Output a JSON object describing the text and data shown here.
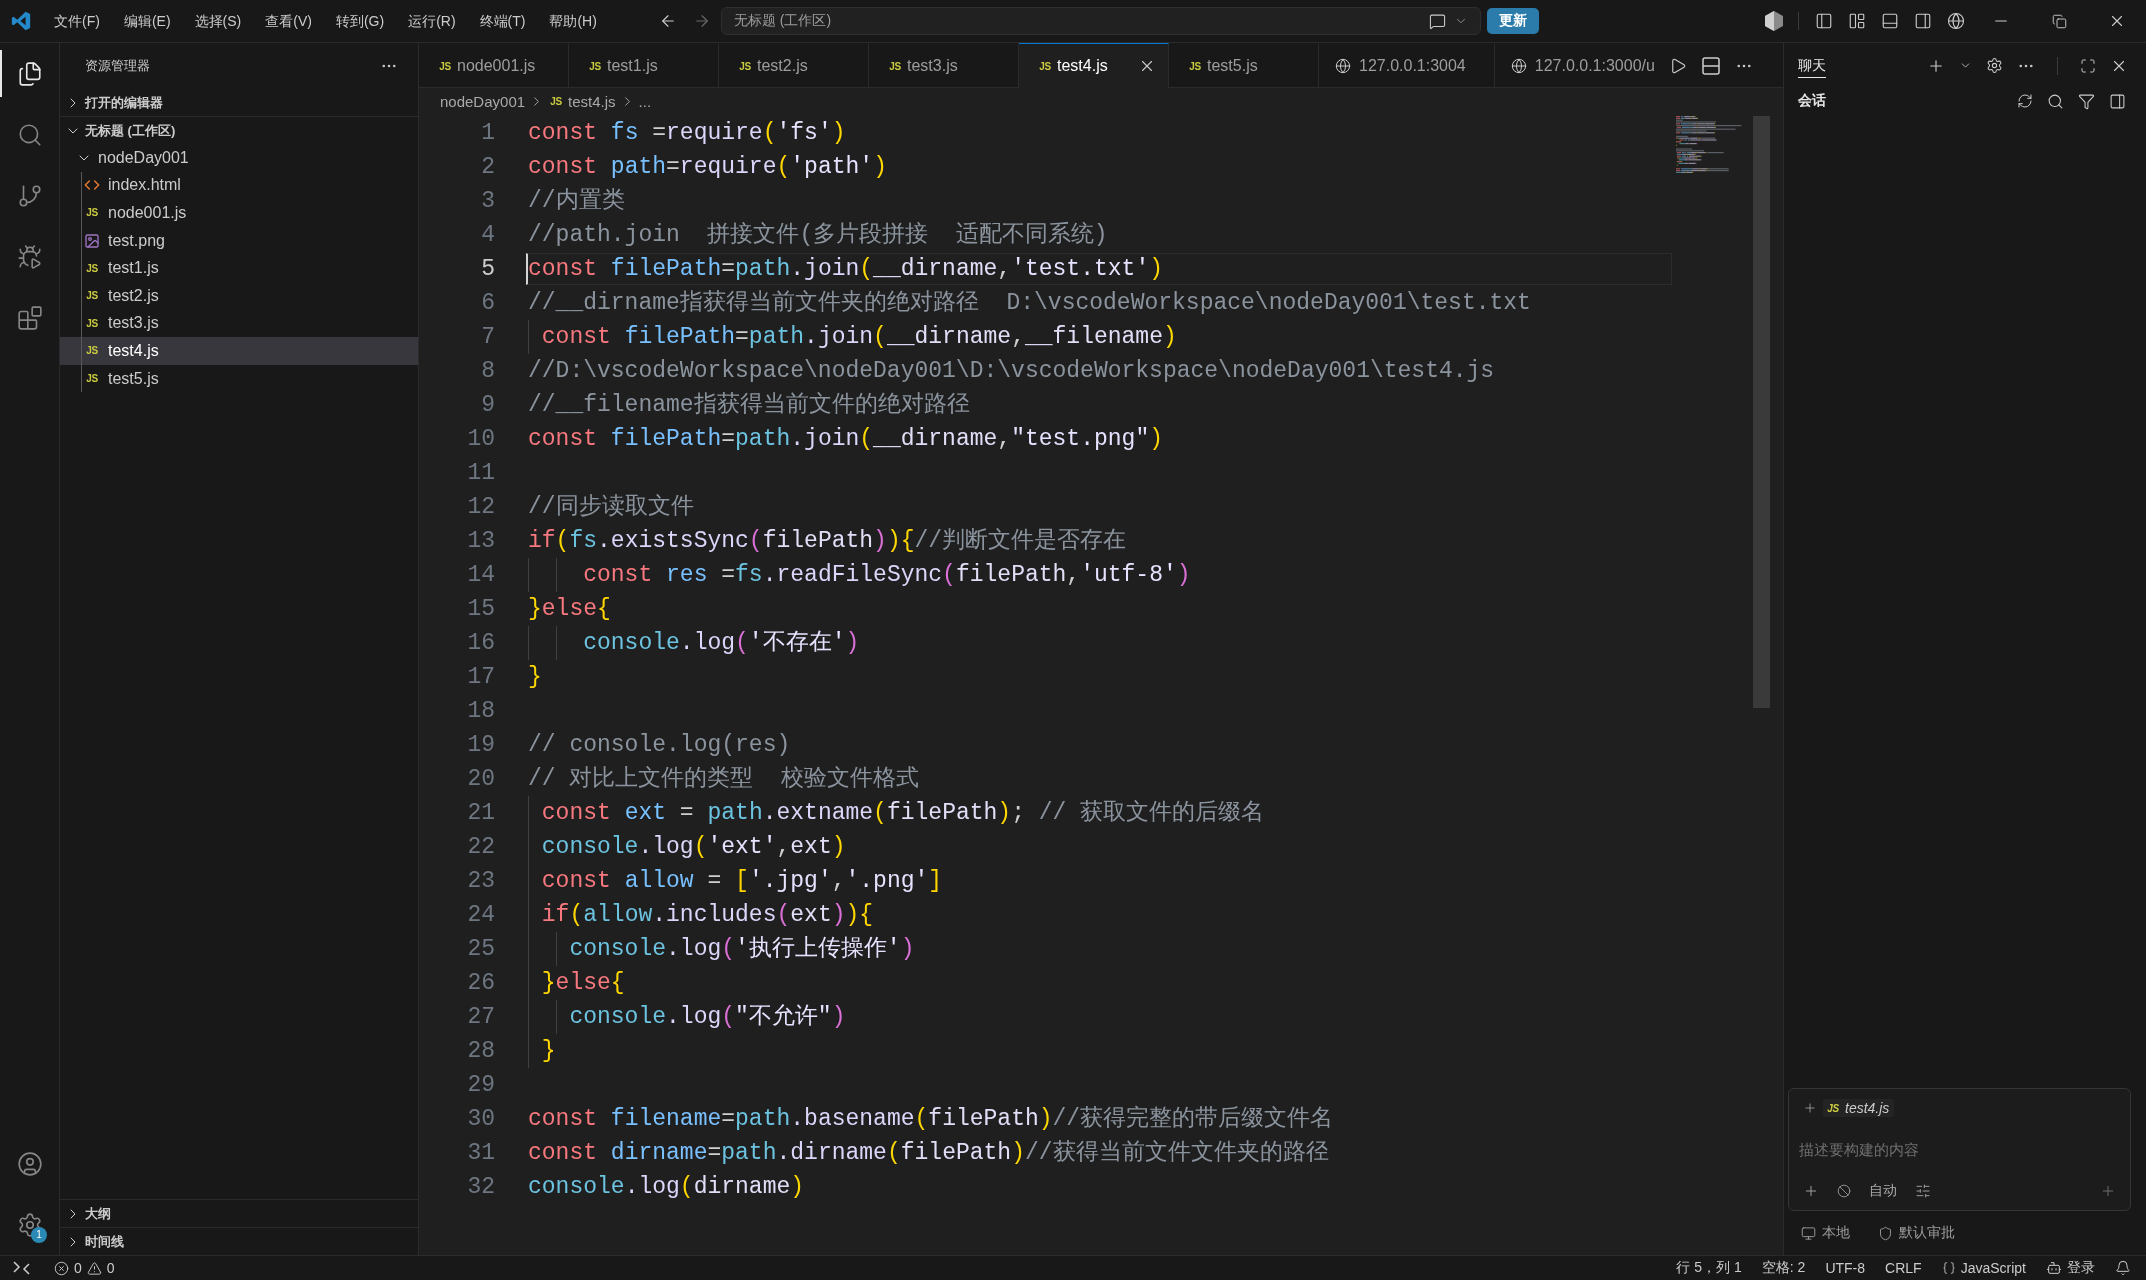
{
  "title_bar": {
    "menus": [
      "文件(F)",
      "编辑(E)",
      "选择(S)",
      "查看(V)",
      "转到(G)",
      "运行(R)",
      "终端(T)",
      "帮助(H)"
    ],
    "command_center": "无标题 (工作区)",
    "update_button": "更新"
  },
  "activity_bar": {
    "items": [
      {
        "kind": "explorer",
        "selected": true
      },
      {
        "kind": "search",
        "selected": false
      },
      {
        "kind": "source_control",
        "selected": false
      },
      {
        "kind": "run_debug",
        "selected": false
      },
      {
        "kind": "extensions",
        "selected": false
      }
    ],
    "bottom_items": [
      {
        "kind": "account"
      },
      {
        "kind": "settings",
        "badge": "1"
      }
    ]
  },
  "sidebar": {
    "title": "资源管理器",
    "sections": [
      {
        "label": "打开的编辑器",
        "expanded": false
      },
      {
        "label": "无标题 (工作区)",
        "expanded": true,
        "children": [
          {
            "kind": "folder",
            "name": "nodeDay001",
            "expanded": true,
            "selected": false,
            "children": [
              {
                "kind": "html",
                "name": "index.html",
                "selected": false
              },
              {
                "kind": "js",
                "icon_label": "JS",
                "name": "node001.js",
                "selected": false
              },
              {
                "kind": "image",
                "name": "test.png",
                "selected": false
              },
              {
                "kind": "js",
                "icon_label": "JS",
                "name": "test1.js",
                "selected": false
              },
              {
                "kind": "js",
                "icon_label": "JS",
                "name": "test2.js",
                "selected": false
              },
              {
                "kind": "js",
                "icon_label": "JS",
                "name": "test3.js",
                "selected": false
              },
              {
                "kind": "js",
                "icon_label": "JS",
                "name": "test4.js",
                "selected": true
              },
              {
                "kind": "js",
                "icon_label": "JS",
                "name": "test5.js",
                "selected": false
              }
            ]
          }
        ]
      }
    ],
    "bottom_sections": [
      {
        "label": "大纲",
        "expanded": false
      },
      {
        "label": "时间线",
        "expanded": false
      }
    ]
  },
  "editor": {
    "tabs": [
      {
        "kind": "js",
        "icon_label": "JS",
        "label": "node001.js",
        "selected": false
      },
      {
        "kind": "js",
        "icon_label": "JS",
        "label": "test1.js",
        "selected": false
      },
      {
        "kind": "js",
        "icon_label": "JS",
        "label": "test2.js",
        "selected": false
      },
      {
        "kind": "js",
        "icon_label": "JS",
        "label": "test3.js",
        "selected": false
      },
      {
        "kind": "js",
        "icon_label": "JS",
        "label": "test4.js",
        "selected": true
      },
      {
        "kind": "js",
        "icon_label": "JS",
        "label": "test5.js",
        "selected": false
      },
      {
        "kind": "browser",
        "label": "127.0.0.1:3004",
        "selected": false
      },
      {
        "kind": "browser",
        "label": "127.0.0.1:3000/u",
        "selected": false
      }
    ],
    "breadcrumb": [
      {
        "kind": "folder",
        "label": "nodeDay001"
      },
      {
        "kind": "js",
        "icon_label": "JS",
        "label": "test4.js"
      },
      {
        "kind": "more",
        "label": "..."
      }
    ],
    "lines": [
      {
        "number": "1",
        "current": false,
        "tokens": [
          {
            "kind": "keyword",
            "text": "const "
          },
          {
            "kind": "variable",
            "text": "fs"
          },
          {
            "kind": "plain",
            "text": " ="
          },
          {
            "kind": "function",
            "text": "require"
          },
          {
            "kind": "bracket1",
            "text": "("
          },
          {
            "kind": "string",
            "text": "'fs'"
          },
          {
            "kind": "bracket1",
            "text": ")"
          }
        ]
      },
      {
        "number": "2",
        "current": false,
        "tokens": [
          {
            "kind": "keyword",
            "text": "const "
          },
          {
            "kind": "variable",
            "text": "path"
          },
          {
            "kind": "plain",
            "text": "="
          },
          {
            "kind": "function",
            "text": "require"
          },
          {
            "kind": "bracket1",
            "text": "("
          },
          {
            "kind": "string",
            "text": "'path'"
          },
          {
            "kind": "bracket1",
            "text": ")"
          }
        ]
      },
      {
        "number": "3",
        "current": false,
        "tokens": [
          {
            "kind": "comment",
            "text": "//内置类"
          }
        ]
      },
      {
        "number": "4",
        "current": false,
        "tokens": [
          {
            "kind": "comment",
            "text": "//path.join  拼接文件(多片段拼接  适配不同系统)"
          }
        ]
      },
      {
        "number": "5",
        "current": true,
        "tokens": [
          {
            "kind": "keyword",
            "text": "const "
          },
          {
            "kind": "variable",
            "text": "filePath"
          },
          {
            "kind": "plain",
            "text": "="
          },
          {
            "kind": "object",
            "text": "path"
          },
          {
            "kind": "function",
            "text": ".join"
          },
          {
            "kind": "bracket1",
            "text": "("
          },
          {
            "kind": "identifier",
            "text": "__dirname"
          },
          {
            "kind": "plain",
            "text": ","
          },
          {
            "kind": "string",
            "text": "'test.txt'"
          },
          {
            "kind": "bracket1",
            "text": ")"
          }
        ]
      },
      {
        "number": "6",
        "current": false,
        "tokens": [
          {
            "kind": "comment",
            "text": "//__dirname指获得当前文件夹的绝对路径  D:\\vscodeWorkspace\\nodeDay001\\test.txt"
          }
        ]
      },
      {
        "number": "7",
        "current": false,
        "tokens": [
          {
            "kind": "keyword",
            "text": " const "
          },
          {
            "kind": "variable",
            "text": "filePath"
          },
          {
            "kind": "plain",
            "text": "="
          },
          {
            "kind": "object",
            "text": "path"
          },
          {
            "kind": "function",
            "text": ".join"
          },
          {
            "kind": "bracket1",
            "text": "("
          },
          {
            "kind": "identifier",
            "text": "__dirname"
          },
          {
            "kind": "plain",
            "text": ","
          },
          {
            "kind": "identifier",
            "text": "__filename"
          },
          {
            "kind": "bracket1",
            "text": ")"
          }
        ]
      },
      {
        "number": "8",
        "current": false,
        "tokens": [
          {
            "kind": "comment",
            "text": "//D:\\vscodeWorkspace\\nodeDay001\\D:\\vscodeWorkspace\\nodeDay001\\test4.js"
          }
        ]
      },
      {
        "number": "9",
        "current": false,
        "tokens": [
          {
            "kind": "comment",
            "text": "//__filename指获得当前文件的绝对路径"
          }
        ]
      },
      {
        "number": "10",
        "current": false,
        "tokens": [
          {
            "kind": "keyword",
            "text": "const "
          },
          {
            "kind": "variable",
            "text": "filePath"
          },
          {
            "kind": "plain",
            "text": "="
          },
          {
            "kind": "object",
            "text": "path"
          },
          {
            "kind": "function",
            "text": ".join"
          },
          {
            "kind": "bracket1",
            "text": "("
          },
          {
            "kind": "identifier",
            "text": "__dirname"
          },
          {
            "kind": "plain",
            "text": ","
          },
          {
            "kind": "string",
            "text": "\"test.png\""
          },
          {
            "kind": "bracket1",
            "text": ")"
          }
        ]
      },
      {
        "number": "11",
        "current": false
      },
      {
        "number": "12",
        "current": false,
        "tokens": [
          {
            "kind": "comment",
            "text": "//同步读取文件"
          }
        ]
      },
      {
        "number": "13",
        "current": false,
        "tokens": [
          {
            "kind": "keyword",
            "text": "if"
          },
          {
            "kind": "bracket1",
            "text": "("
          },
          {
            "kind": "object",
            "text": "fs"
          },
          {
            "kind": "function",
            "text": ".existsSync"
          },
          {
            "kind": "bracket2",
            "text": "("
          },
          {
            "kind": "identifier",
            "text": "filePath"
          },
          {
            "kind": "bracket2",
            "text": ")"
          },
          {
            "kind": "bracket1",
            "text": ")"
          },
          {
            "kind": "bracket1",
            "text": "{"
          },
          {
            "kind": "comment",
            "text": "//判断文件是否存在"
          }
        ]
      },
      {
        "number": "14",
        "current": false,
        "tokens": [
          {
            "kind": "keyword",
            "text": "    const "
          },
          {
            "kind": "variable",
            "text": "res"
          },
          {
            "kind": "plain",
            "text": " ="
          },
          {
            "kind": "object",
            "text": "fs"
          },
          {
            "kind": "function",
            "text": ".readFileSync"
          },
          {
            "kind": "bracket2",
            "text": "("
          },
          {
            "kind": "identifier",
            "text": "filePath"
          },
          {
            "kind": "plain",
            "text": ","
          },
          {
            "kind": "string",
            "text": "'utf-8'"
          },
          {
            "kind": "bracket2",
            "text": ")"
          }
        ]
      },
      {
        "number": "15",
        "current": false,
        "tokens": [
          {
            "kind": "bracket1",
            "text": "}"
          },
          {
            "kind": "keyword",
            "text": "else"
          },
          {
            "kind": "bracket1",
            "text": "{"
          }
        ]
      },
      {
        "number": "16",
        "current": false,
        "tokens": [
          {
            "kind": "object",
            "text": "    console"
          },
          {
            "kind": "function",
            "text": ".log"
          },
          {
            "kind": "bracket2",
            "text": "("
          },
          {
            "kind": "string",
            "text": "'不存在'"
          },
          {
            "kind": "bracket2",
            "text": ")"
          }
        ]
      },
      {
        "number": "17",
        "current": false,
        "tokens": [
          {
            "kind": "bracket1",
            "text": "}"
          }
        ]
      },
      {
        "number": "18",
        "current": false
      },
      {
        "number": "19",
        "current": false,
        "tokens": [
          {
            "kind": "comment",
            "text": "// console.log(res)"
          }
        ]
      },
      {
        "number": "20",
        "current": false,
        "tokens": [
          {
            "kind": "comment",
            "text": "// 对比上文件的类型  校验文件格式"
          }
        ]
      },
      {
        "number": "21",
        "current": false,
        "tokens": [
          {
            "kind": "keyword",
            "text": " const "
          },
          {
            "kind": "variable",
            "text": "ext"
          },
          {
            "kind": "plain",
            "text": " = "
          },
          {
            "kind": "object",
            "text": "path"
          },
          {
            "kind": "function",
            "text": ".extname"
          },
          {
            "kind": "bracket1",
            "text": "("
          },
          {
            "kind": "identifier",
            "text": "filePath"
          },
          {
            "kind": "bracket1",
            "text": ")"
          },
          {
            "kind": "plain",
            "text": ";"
          },
          {
            "kind": "comment",
            "text": " // 获取文件的后缀名"
          }
        ]
      },
      {
        "number": "22",
        "current": false,
        "tokens": [
          {
            "kind": "object",
            "text": " console"
          },
          {
            "kind": "function",
            "text": ".log"
          },
          {
            "kind": "bracket1",
            "text": "("
          },
          {
            "kind": "string",
            "text": "'ext'"
          },
          {
            "kind": "plain",
            "text": ","
          },
          {
            "kind": "identifier",
            "text": "ext"
          },
          {
            "kind": "bracket1",
            "text": ")"
          }
        ]
      },
      {
        "number": "23",
        "current": false,
        "tokens": [
          {
            "kind": "keyword",
            "text": " const "
          },
          {
            "kind": "variable",
            "text": "allow"
          },
          {
            "kind": "plain",
            "text": " = "
          },
          {
            "kind": "bracket1",
            "text": "["
          },
          {
            "kind": "string",
            "text": "'.jpg'"
          },
          {
            "kind": "plain",
            "text": ","
          },
          {
            "kind": "string",
            "text": "'.png'"
          },
          {
            "kind": "bracket1",
            "text": "]"
          }
        ]
      },
      {
        "number": "24",
        "current": false,
        "tokens": [
          {
            "kind": "keyword",
            "text": " if"
          },
          {
            "kind": "bracket1",
            "text": "("
          },
          {
            "kind": "object",
            "text": "allow"
          },
          {
            "kind": "function",
            "text": ".includes"
          },
          {
            "kind": "bracket2",
            "text": "("
          },
          {
            "kind": "identifier",
            "text": "ext"
          },
          {
            "kind": "bracket2",
            "text": ")"
          },
          {
            "kind": "bracket1",
            "text": ")"
          },
          {
            "kind": "bracket1",
            "text": "{"
          }
        ]
      },
      {
        "number": "25",
        "current": false,
        "tokens": [
          {
            "kind": "object",
            "text": "   console"
          },
          {
            "kind": "function",
            "text": ".log"
          },
          {
            "kind": "bracket2",
            "text": "("
          },
          {
            "kind": "string",
            "text": "'执行上传操作'"
          },
          {
            "kind": "bracket2",
            "text": ")"
          }
        ]
      },
      {
        "number": "26",
        "current": false,
        "tokens": [
          {
            "kind": "bracket1",
            "text": " }"
          },
          {
            "kind": "keyword",
            "text": "else"
          },
          {
            "kind": "bracket1",
            "text": "{"
          }
        ]
      },
      {
        "number": "27",
        "current": false,
        "tokens": [
          {
            "kind": "object",
            "text": "   console"
          },
          {
            "kind": "function",
            "text": ".log"
          },
          {
            "kind": "bracket2",
            "text": "("
          },
          {
            "kind": "string",
            "text": "\"不允许\""
          },
          {
            "kind": "bracket2",
            "text": ")"
          }
        ]
      },
      {
        "number": "28",
        "current": false,
        "tokens": [
          {
            "kind": "bracket1",
            "text": " }"
          }
        ]
      },
      {
        "number": "29",
        "current": false
      },
      {
        "number": "30",
        "current": false,
        "tokens": [
          {
            "kind": "keyword",
            "text": "const "
          },
          {
            "kind": "variable",
            "text": "filename"
          },
          {
            "kind": "plain",
            "text": "="
          },
          {
            "kind": "object",
            "text": "path"
          },
          {
            "kind": "function",
            "text": ".basename"
          },
          {
            "kind": "bracket1",
            "text": "("
          },
          {
            "kind": "identifier",
            "text": "filePath"
          },
          {
            "kind": "bracket1",
            "text": ")"
          },
          {
            "kind": "comment",
            "text": "//获得完整的带后缀文件名"
          }
        ]
      },
      {
        "number": "31",
        "current": false,
        "tokens": [
          {
            "kind": "keyword",
            "text": "const "
          },
          {
            "kind": "variable",
            "text": "dirname"
          },
          {
            "kind": "plain",
            "text": "="
          },
          {
            "kind": "object",
            "text": "path"
          },
          {
            "kind": "function",
            "text": ".dirname"
          },
          {
            "kind": "bracket1",
            "text": "("
          },
          {
            "kind": "identifier",
            "text": "filePath"
          },
          {
            "kind": "bracket1",
            "text": ")"
          },
          {
            "kind": "comment",
            "text": "//获得当前文件文件夹的路径"
          }
        ]
      },
      {
        "number": "32",
        "current": false,
        "tokens": [
          {
            "kind": "object",
            "text": "console"
          },
          {
            "kind": "function",
            "text": ".log"
          },
          {
            "kind": "bracket1",
            "text": "("
          },
          {
            "kind": "identifier",
            "text": "dirname"
          },
          {
            "kind": "bracket1",
            "text": ")"
          }
        ]
      }
    ]
  },
  "chat": {
    "tabs": [
      {
        "label": "聊天",
        "selected": true
      }
    ],
    "section_title": "会话",
    "input": {
      "attachment": {
        "icon_label": "JS",
        "name": "test4.js"
      },
      "placeholder": "描述要构建的内容",
      "mode": "自动"
    },
    "footer": [
      {
        "kind": "local",
        "label": "本地"
      },
      {
        "kind": "approval",
        "label": "默认审批"
      }
    ]
  },
  "status_bar": {
    "errors": "0",
    "warnings": "0",
    "items": [
      {
        "kind": "text",
        "label": "行 5，列 1"
      },
      {
        "kind": "text",
        "label": "空格: 2"
      },
      {
        "kind": "text",
        "label": "UTF-8"
      },
      {
        "kind": "text",
        "label": "CRLF"
      },
      {
        "kind": "language",
        "label": "JavaScript"
      },
      {
        "kind": "account",
        "label": "登录"
      },
      {
        "kind": "notifications"
      }
    ]
  }
}
